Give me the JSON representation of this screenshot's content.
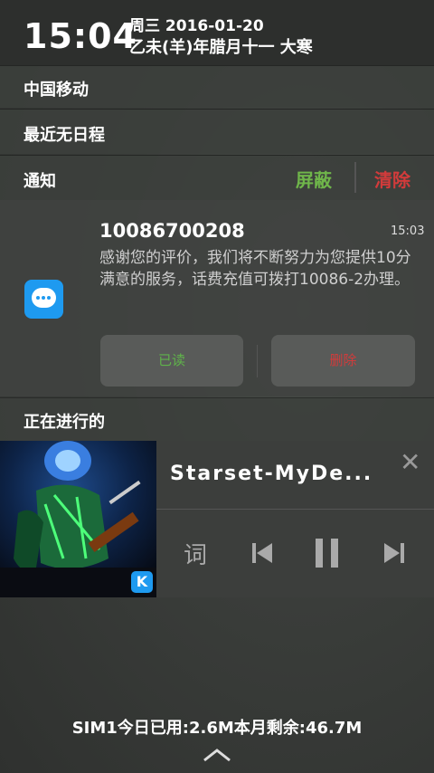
{
  "status": {
    "time": "15:04",
    "date_line": "周三 2016-01-20",
    "lunar_line": "乙未(羊)年腊月十一 大寒"
  },
  "carrier": "中国移动",
  "schedule": "最近无日程",
  "notifications": {
    "title": "通知",
    "shield_label": "屏蔽",
    "clear_label": "清除",
    "shield_color": "#6fb64a",
    "clear_color": "#d23b3b",
    "item": {
      "sender": "10086700208",
      "time": "15:03",
      "body": "感谢您的评价，我们将不断努力为您提供10分满意的服务，话费充值可拨打10086-2办理。",
      "read_label": "已读",
      "delete_label": "删除",
      "icon": "message-bubble-icon"
    }
  },
  "ongoing": {
    "title": "正在进行的",
    "player": {
      "song": "Starset-MyDe...",
      "lyric_label": "词",
      "badge": "K"
    }
  },
  "footer": {
    "data_usage": "SIM1今日已用:2.6M本月剩余:46.7M"
  }
}
